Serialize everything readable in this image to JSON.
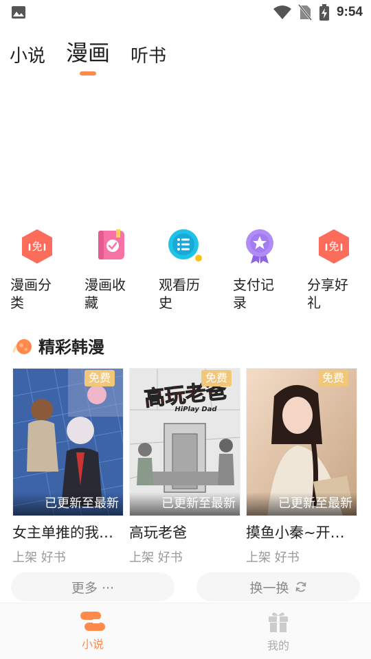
{
  "status_bar": {
    "time": "9:54"
  },
  "top_tabs": [
    {
      "label": "小说",
      "active": false
    },
    {
      "label": "漫画",
      "active": true
    },
    {
      "label": "听书",
      "active": false
    }
  ],
  "shortcuts": [
    {
      "label": "漫画分类",
      "icon": "free-hexagon-icon"
    },
    {
      "label": "漫画收藏",
      "icon": "bookmark-book-icon"
    },
    {
      "label": "观看历史",
      "icon": "history-list-icon"
    },
    {
      "label": "支付记录",
      "icon": "badge-star-icon"
    },
    {
      "label": "分享好礼",
      "icon": "free-hexagon-icon"
    }
  ],
  "section": {
    "title": "精彩韩漫"
  },
  "cards": [
    {
      "badge": "免费",
      "caption": "已更新至最新",
      "title": "女主单推的我…",
      "sub": "上架 好书"
    },
    {
      "badge": "免费",
      "caption": "已更新至最新",
      "title": "高玩老爸",
      "sub": "上架 好书",
      "cover_title": "高玩老爸",
      "cover_subtitle": "HiPlay Dad"
    },
    {
      "badge": "免费",
      "caption": "已更新至最新",
      "title": "摸鱼小秦~开…",
      "sub": "上架 好书"
    }
  ],
  "buttons": {
    "more": "更多 ···",
    "refresh": "换一换"
  },
  "bottom_nav": [
    {
      "label": "小说",
      "active": true
    },
    {
      "label": "我的",
      "active": false
    }
  ],
  "colors": {
    "accent": "#ff8a4c",
    "badge": "#f2c77a",
    "icon_red": "#fb6c5a",
    "icon_pink": "#f773a6",
    "icon_cyan": "#1fc3e6",
    "icon_purple": "#a37cf2"
  }
}
